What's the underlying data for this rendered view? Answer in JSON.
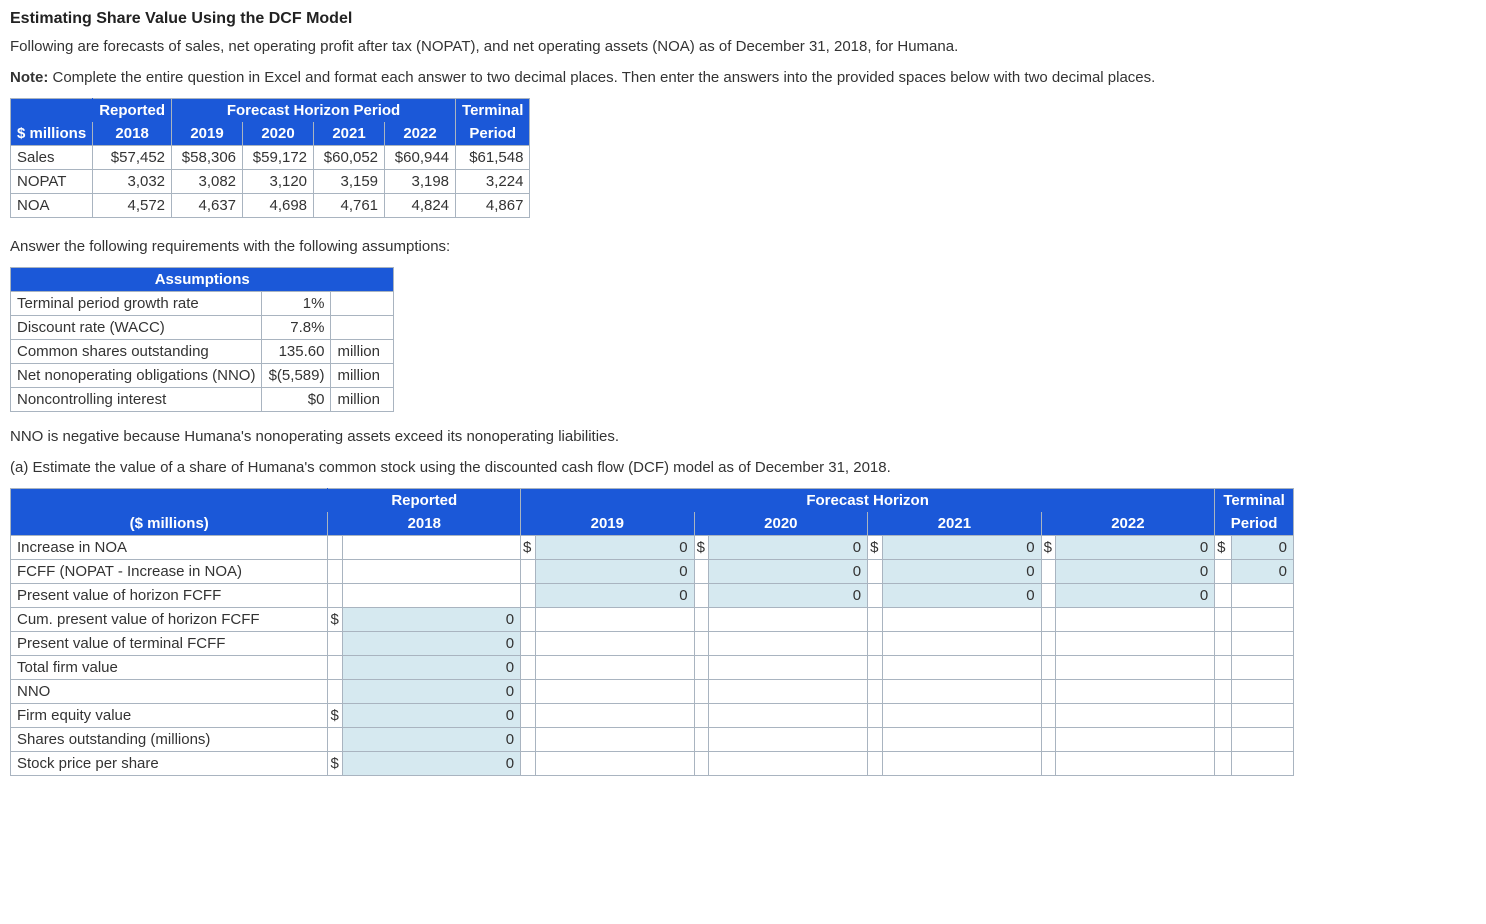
{
  "title": "Estimating Share Value Using the DCF Model",
  "intro": "Following are forecasts of sales, net operating profit after tax (NOPAT), and net operating assets (NOA) as of December 31, 2018, for Humana.",
  "note_label": "Note:",
  "note_text": " Complete the entire question in Excel and format each answer to two decimal places. Then enter the answers into the provided spaces below with two decimal places.",
  "forecast_table": {
    "col_group1": "Reported",
    "col_group2": "Forecast Horizon Period",
    "col_group3": "Terminal",
    "row_header": "$ millions",
    "years": [
      "2018",
      "2019",
      "2020",
      "2021",
      "2022"
    ],
    "terminal_label": "Period",
    "rows": [
      {
        "label": "Sales",
        "vals": [
          "$57,452",
          "$58,306",
          "$59,172",
          "$60,052",
          "$60,944",
          "$61,548"
        ]
      },
      {
        "label": "NOPAT",
        "vals": [
          "3,032",
          "3,082",
          "3,120",
          "3,159",
          "3,198",
          "3,224"
        ]
      },
      {
        "label": "NOA",
        "vals": [
          "4,572",
          "4,637",
          "4,698",
          "4,761",
          "4,824",
          "4,867"
        ]
      }
    ]
  },
  "assump_intro": "Answer the following requirements with the following assumptions:",
  "assumptions": {
    "header": "Assumptions",
    "rows": [
      {
        "label": "Terminal period growth rate",
        "val": "1%",
        "unit": ""
      },
      {
        "label": "Discount rate (WACC)",
        "val": "7.8%",
        "unit": ""
      },
      {
        "label": "Common shares outstanding",
        "val": "135.60",
        "unit": "million"
      },
      {
        "label": "Net nonoperating obligations (NNO)",
        "val": "$(5,589)",
        "unit": "million"
      },
      {
        "label": "Noncontrolling interest",
        "val": "$0",
        "unit": "million"
      }
    ]
  },
  "nno_note": "NNO is negative because Humana's nonoperating assets exceed its nonoperating liabilities.",
  "part_a": "(a) Estimate the value of a share of Humana's common stock using the discounted cash flow (DCF) model as of December 31, 2018.",
  "dcf": {
    "hdr_group1": "Reported",
    "hdr_group2": "Forecast Horizon",
    "hdr_group3": "Terminal",
    "row_header": "($ millions)",
    "years": [
      "2018",
      "2019",
      "2020",
      "2021",
      "2022"
    ],
    "terminal_label": "Period",
    "rows": {
      "increase_noa": "Increase in NOA",
      "fcff": "FCFF (NOPAT - Increase in NOA)",
      "pv_fcff": "Present value of horizon FCFF",
      "cum_pv": "Cum. present value of horizon FCFF",
      "pv_term": "Present value of terminal FCFF",
      "firm_value": "Total firm value",
      "nno": "NNO",
      "equity": "Firm equity value",
      "shares": "Shares outstanding (millions)",
      "price": "Stock price per share"
    },
    "zero": "0",
    "dollar": "$"
  }
}
